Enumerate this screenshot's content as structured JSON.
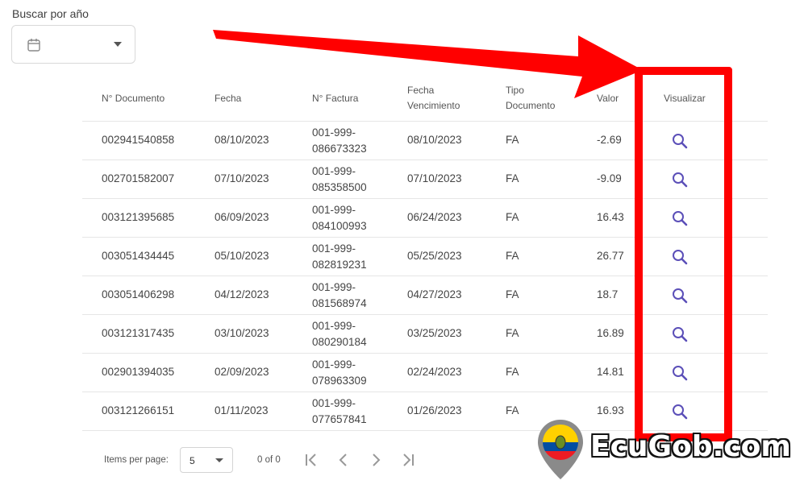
{
  "search": {
    "label": "Buscar por año",
    "value": ""
  },
  "table": {
    "headers": {
      "documento": "N° Documento",
      "fecha": "Fecha",
      "factura": "N° Factura",
      "vencimiento_1": "Fecha",
      "vencimiento_2": "Vencimiento",
      "tipo_1": "Tipo",
      "tipo_2": "Documento",
      "valor": "Valor",
      "visualizar": "Visualizar"
    },
    "rows": [
      {
        "documento": "002941540858",
        "fecha": "08/10/2023",
        "factura_1": "001-999-",
        "factura_2": "086673323",
        "vencimiento": "08/10/2023",
        "tipo": "FA",
        "valor": "-2.69"
      },
      {
        "documento": "002701582007",
        "fecha": "07/10/2023",
        "factura_1": "001-999-",
        "factura_2": "085358500",
        "vencimiento": "07/10/2023",
        "tipo": "FA",
        "valor": "-9.09"
      },
      {
        "documento": "003121395685",
        "fecha": "06/09/2023",
        "factura_1": "001-999-",
        "factura_2": "084100993",
        "vencimiento": "06/24/2023",
        "tipo": "FA",
        "valor": "16.43"
      },
      {
        "documento": "003051434445",
        "fecha": "05/10/2023",
        "factura_1": "001-999-",
        "factura_2": "082819231",
        "vencimiento": "05/25/2023",
        "tipo": "FA",
        "valor": "26.77"
      },
      {
        "documento": "003051406298",
        "fecha": "04/12/2023",
        "factura_1": "001-999-",
        "factura_2": "081568974",
        "vencimiento": "04/27/2023",
        "tipo": "FA",
        "valor": "18.7"
      },
      {
        "documento": "003121317435",
        "fecha": "03/10/2023",
        "factura_1": "001-999-",
        "factura_2": "080290184",
        "vencimiento": "03/25/2023",
        "tipo": "FA",
        "valor": "16.89"
      },
      {
        "documento": "002901394035",
        "fecha": "02/09/2023",
        "factura_1": "001-999-",
        "factura_2": "078963309",
        "vencimiento": "02/24/2023",
        "tipo": "FA",
        "valor": "14.81"
      },
      {
        "documento": "003121266151",
        "fecha": "01/11/2023",
        "factura_1": "001-999-",
        "factura_2": "077657841",
        "vencimiento": "01/26/2023",
        "tipo": "FA",
        "valor": "16.93"
      }
    ]
  },
  "pagination": {
    "items_per_page_label": "Items per page:",
    "items_per_page_value": "5",
    "range": "0 of 0"
  },
  "watermark": {
    "brand": "EcuGob.com"
  },
  "colors": {
    "accent_icon": "#5b4fb8",
    "annotation": "#ff0000"
  },
  "icons": {
    "picker": "calendar-icon",
    "view": "search-icon",
    "first": "first-page-icon",
    "prev": "chevron-left-icon",
    "next": "chevron-right-icon",
    "last": "last-page-icon"
  }
}
